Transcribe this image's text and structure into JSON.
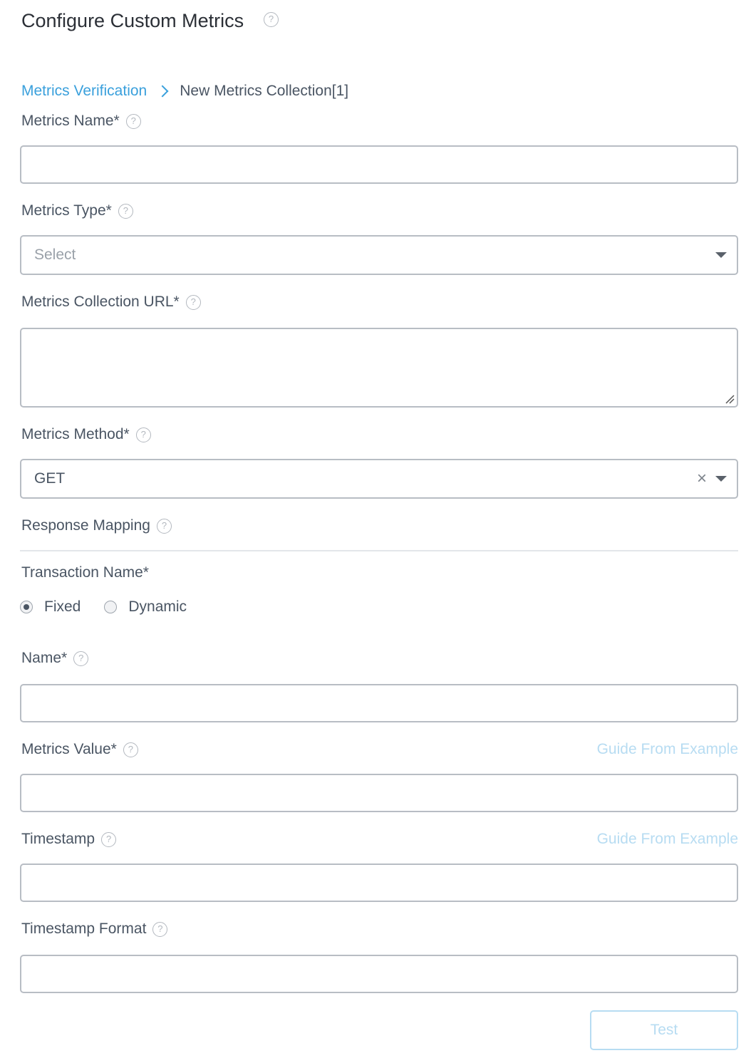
{
  "header": {
    "title": "Configure Custom Metrics",
    "help_icon": "?"
  },
  "breadcrumb": {
    "parent": "Metrics Verification",
    "current": "New Metrics Collection[1]"
  },
  "fields": {
    "metrics_name": {
      "label": "Metrics Name*",
      "value": ""
    },
    "metrics_type": {
      "label": "Metrics Type*",
      "placeholder": "Select"
    },
    "collection_url": {
      "label": "Metrics Collection URL*",
      "value": ""
    },
    "metrics_method": {
      "label": "Metrics Method*",
      "value": "GET",
      "clear_glyph": "×"
    },
    "response_mapping": {
      "label": "Response Mapping"
    },
    "transaction_name": {
      "label": "Transaction Name*",
      "options": [
        {
          "label": "Fixed",
          "selected": true
        },
        {
          "label": "Dynamic",
          "selected": false
        }
      ]
    },
    "name": {
      "label": "Name*",
      "value": ""
    },
    "metrics_value": {
      "label": "Metrics Value*",
      "value": "",
      "guide_link": "Guide From Example"
    },
    "timestamp": {
      "label": "Timestamp",
      "value": "",
      "guide_link": "Guide From Example"
    },
    "timestamp_format": {
      "label": "Timestamp Format",
      "value": ""
    }
  },
  "actions": {
    "test_label": "Test"
  },
  "colors": {
    "link": "#3aa0dc",
    "disabled_link": "#b7dcf2",
    "border": "#b8bdc4",
    "text": "#4a5563"
  }
}
